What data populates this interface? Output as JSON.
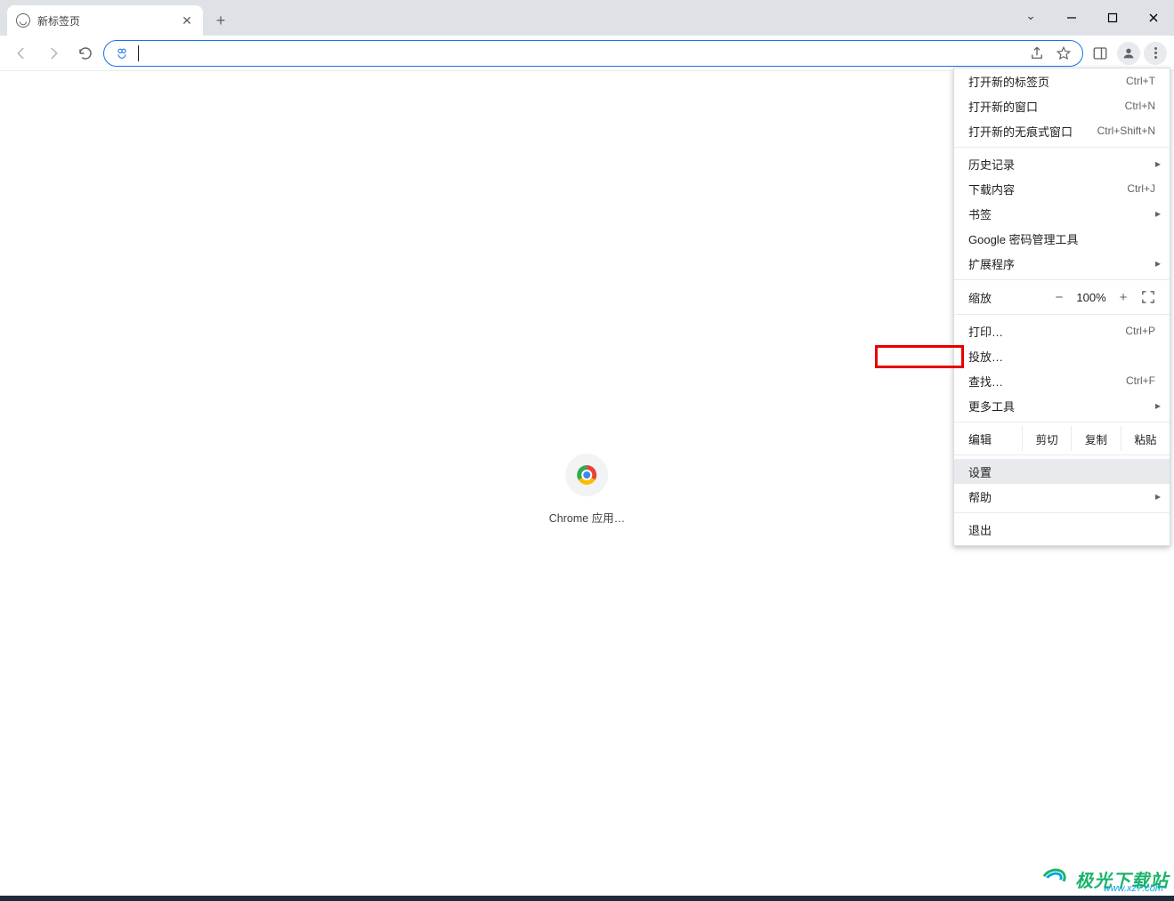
{
  "window": {
    "tab_title": "新标签页",
    "new_tab_plus": "+",
    "omnibox_value": "",
    "controls": {
      "chevron": "⌄",
      "min": "—",
      "max": "☐",
      "close": "✕"
    }
  },
  "content": {
    "shortcut_label": "Chrome 应用…"
  },
  "menu": {
    "new_tab": {
      "label": "打开新的标签页",
      "shortcut": "Ctrl+T"
    },
    "new_window": {
      "label": "打开新的窗口",
      "shortcut": "Ctrl+N"
    },
    "incognito": {
      "label": "打开新的无痕式窗口",
      "shortcut": "Ctrl+Shift+N"
    },
    "history": {
      "label": "历史记录"
    },
    "downloads": {
      "label": "下载内容",
      "shortcut": "Ctrl+J"
    },
    "bookmarks": {
      "label": "书签"
    },
    "pwd_manager": {
      "label": "Google 密码管理工具"
    },
    "extensions": {
      "label": "扩展程序"
    },
    "zoom": {
      "label": "缩放",
      "minus": "−",
      "value": "100%",
      "plus": "+"
    },
    "print": {
      "label": "打印…",
      "shortcut": "Ctrl+P"
    },
    "cast": {
      "label": "投放…"
    },
    "find": {
      "label": "查找…",
      "shortcut": "Ctrl+F"
    },
    "more_tools": {
      "label": "更多工具"
    },
    "edit": {
      "label": "编辑",
      "cut": "剪切",
      "copy": "复制",
      "paste": "粘贴"
    },
    "settings": {
      "label": "设置"
    },
    "help": {
      "label": "帮助"
    },
    "exit": {
      "label": "退出"
    }
  },
  "watermark": {
    "brand": "极光下载站",
    "url": "www.xz7.com"
  }
}
